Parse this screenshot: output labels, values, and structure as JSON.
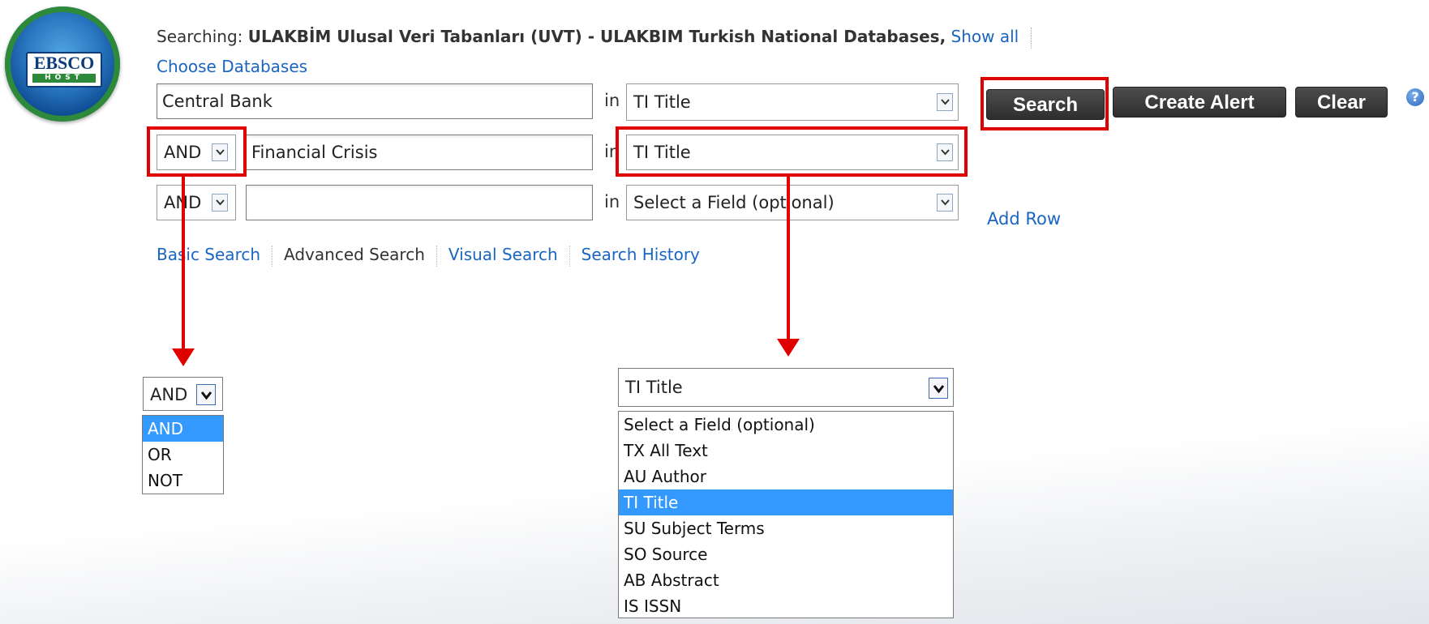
{
  "header": {
    "searching_label": "Searching:",
    "database_name": "ULAKBİM Ulusal Veri Tabanları (UVT) - ULAKBIM Turkish National Databases,",
    "show_all": "Show all",
    "choose_databases": "Choose Databases"
  },
  "logo": {
    "main": "EBSCO",
    "sub": "HOST"
  },
  "rows": [
    {
      "operator": "",
      "term": "Central Bank",
      "in": "in",
      "field": "TI Title"
    },
    {
      "operator": "AND",
      "term": "Financial Crisis",
      "in": "in",
      "field": "TI Title"
    },
    {
      "operator": "AND",
      "term": "",
      "in": "in",
      "field": "Select a Field (optional)"
    }
  ],
  "buttons": {
    "search": "Search",
    "create_alert": "Create Alert",
    "clear": "Clear",
    "help": "?"
  },
  "add_row": "Add Row",
  "tabs": [
    "Basic Search",
    "Advanced Search",
    "Visual Search",
    "Search History"
  ],
  "operator_dropdown": {
    "selected": "AND",
    "options": [
      "AND",
      "OR",
      "NOT"
    ],
    "highlighted": "AND"
  },
  "field_dropdown": {
    "selected": "TI Title",
    "options": [
      "Select a Field (optional)",
      "TX All Text",
      "AU Author",
      "TI Title",
      "SU Subject Terms",
      "SO Source",
      "AB Abstract",
      "IS ISSN"
    ],
    "highlighted": "TI Title"
  },
  "colors": {
    "link": "#1a65c0",
    "highlight": "#e00000",
    "selection": "#3399ff",
    "button": "#3a3a3a"
  }
}
